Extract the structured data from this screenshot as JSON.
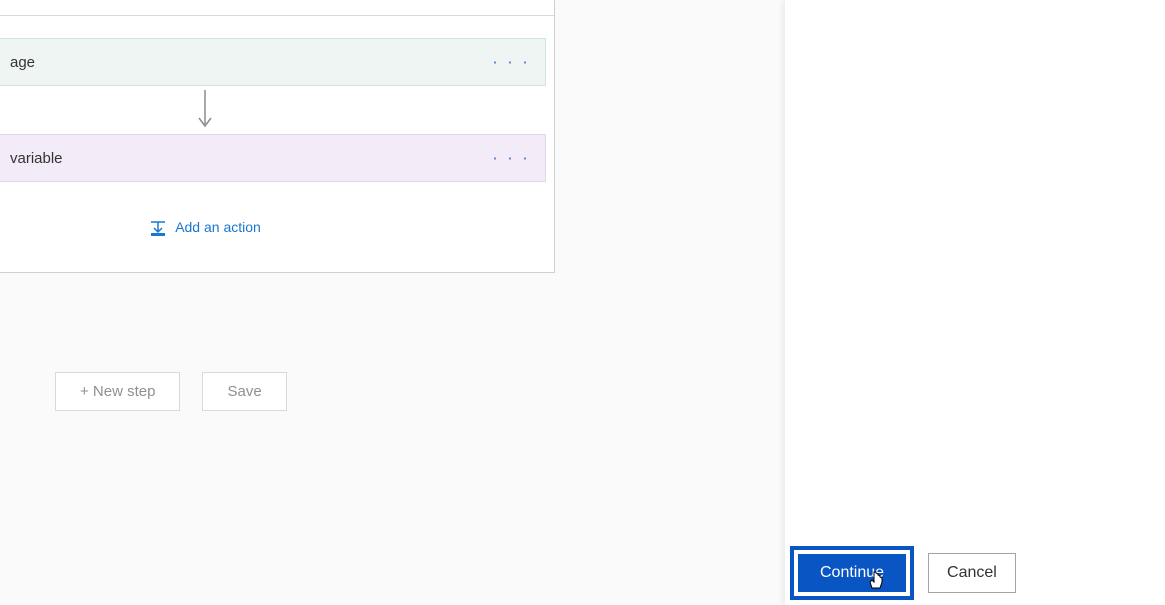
{
  "flow": {
    "cards": [
      {
        "label": "age"
      },
      {
        "label": "variable"
      }
    ],
    "addActionLabel": "Add an action"
  },
  "bottomButtons": {
    "newStep": "+ New step",
    "save": "Save"
  },
  "panel": {
    "continue": "Continue",
    "cancel": "Cancel"
  },
  "ellipsis": "· · ·"
}
